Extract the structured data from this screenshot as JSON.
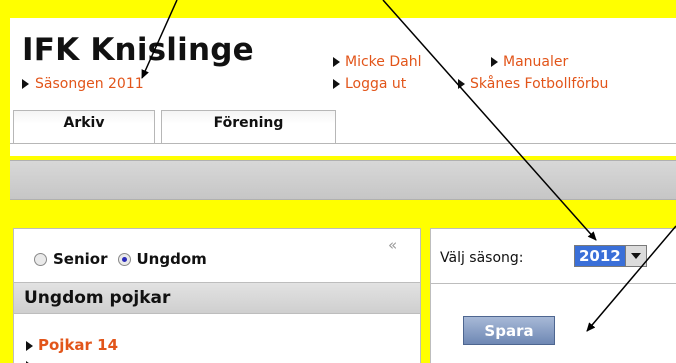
{
  "header": {
    "title": "IFK Knislinge",
    "season_link": "Säsongen 2011",
    "links": [
      "Micke Dahl",
      "Manualer",
      "Logga ut",
      "Skånes Fotbollförbu"
    ]
  },
  "tabs": [
    {
      "label": "Arkiv"
    },
    {
      "label": "Förening"
    }
  ],
  "left_panel": {
    "radios": [
      {
        "label": "Senior",
        "checked": false
      },
      {
        "label": "Ungdom",
        "checked": true
      }
    ],
    "collapse_symbol": "«",
    "section_title": "Ungdom pojkar",
    "items": [
      "Pojkar 14"
    ]
  },
  "right_panel": {
    "season_label": "Välj säsong:",
    "season_value": "2012",
    "save_label": "Spara"
  },
  "colors": {
    "frame": "#ffff00",
    "link": "#e2551a",
    "button": "#7a93bd"
  }
}
